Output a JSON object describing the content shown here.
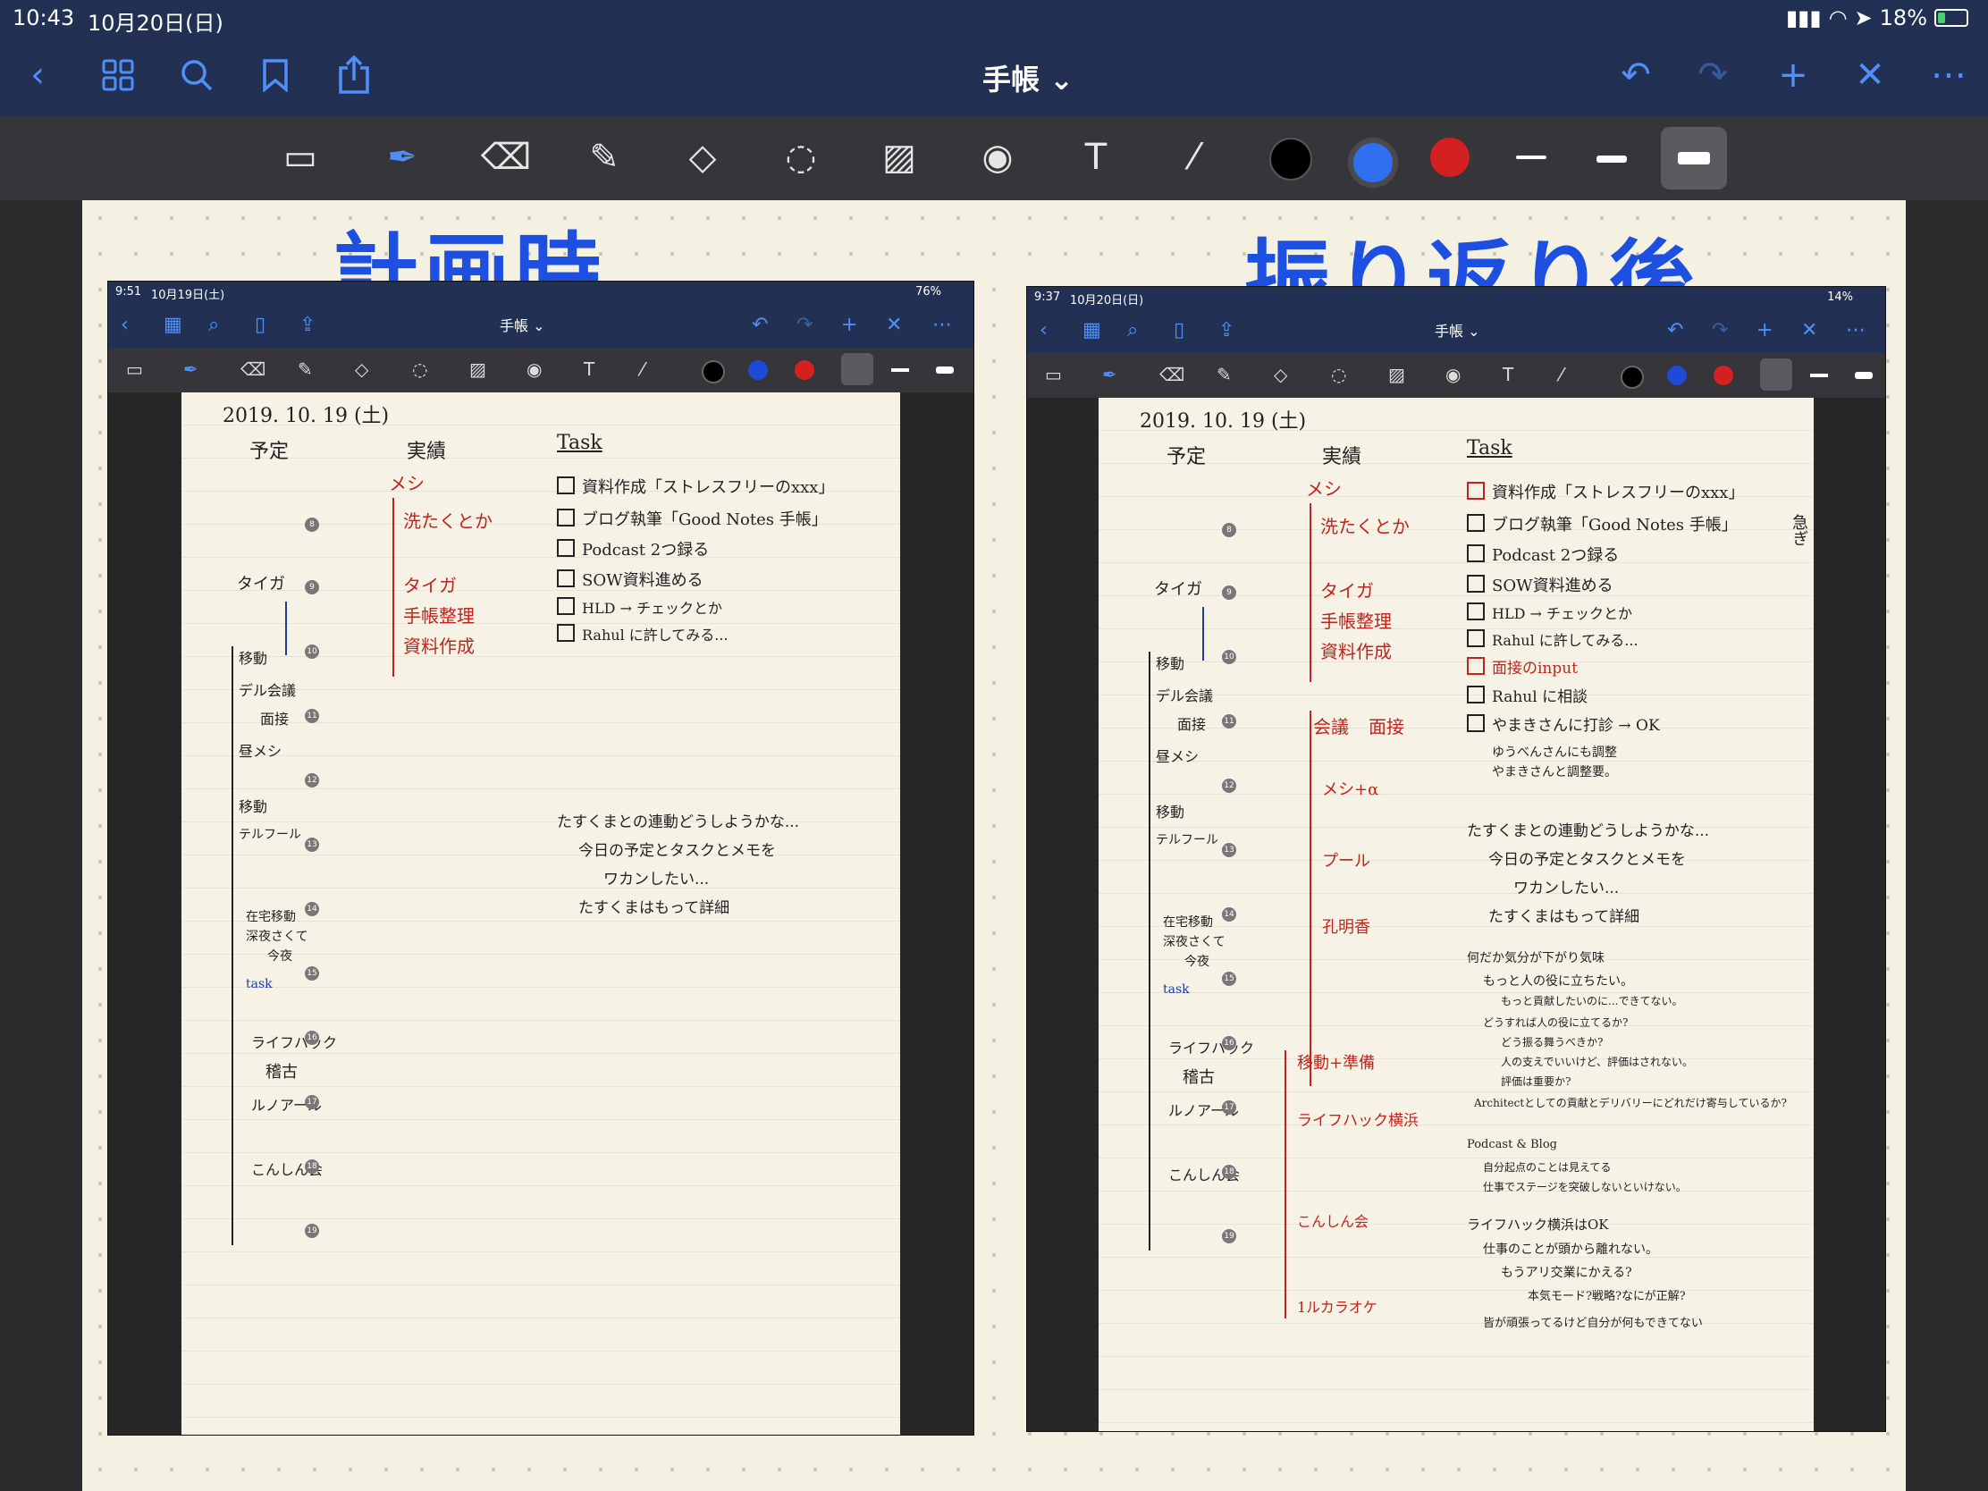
{
  "status": {
    "time": "10:43",
    "date": "10月20日(日)",
    "battery": "18%"
  },
  "nav": {
    "title": "手帳 ⌄"
  },
  "headings": {
    "left": "計画時",
    "right": "振り返り後"
  },
  "left_shot": {
    "status_time": "9:51",
    "status_date": "10月19日(土)",
    "battery": "76%",
    "title": "手帳 ⌄",
    "date_line": "2019. 10. 19 (土)",
    "col_plan": "予定",
    "col_actual": "実績",
    "col_task": "Task",
    "plan": [
      "タイガ",
      "移動",
      "デル会議",
      "面接",
      "昼メシ",
      "移動",
      "テルフール",
      "在宅移動",
      "深夜さくて",
      "今夜",
      "task",
      "ライフハック",
      "稽古",
      "ルノアール",
      "こんしん会"
    ],
    "actual": [
      "メシ",
      "洗たくとか",
      "タイガ",
      "手帳整理",
      "資料作成"
    ],
    "tasks": [
      "資料作成「ストレスフリーのxxx」",
      "ブログ執筆「Good Notes 手帳」",
      "Podcast 2つ録る",
      "SOW資料進める",
      "HLD → チェックとか",
      "Rahul に許してみる..."
    ],
    "memo": [
      "たすくまとの連動どうしようかな...",
      "今日の予定とタスクとメモを",
      "ワカンしたい...",
      "たすくまはもって詳細"
    ]
  },
  "right_shot": {
    "status_time": "9:37",
    "status_date": "10月20日(日)",
    "battery": "14%",
    "title": "手帳 ⌄",
    "date_line": "2019. 10. 19 (土)",
    "col_plan": "予定",
    "col_actual": "実績",
    "col_task": "Task",
    "plan": [
      "タイガ",
      "移動",
      "デル会議",
      "面接",
      "昼メシ",
      "移動",
      "テルフール",
      "在宅移動",
      "深夜さくて",
      "今夜",
      "task",
      "ライフハック",
      "稽古",
      "ルノアール",
      "こんしん会"
    ],
    "actual": [
      "メシ",
      "洗たくとか",
      "タイガ",
      "手帳整理",
      "資料作成",
      "会議",
      "面接",
      "メシ+α",
      "プール",
      "孔明香",
      "移動+準備",
      "ライフハック横浜",
      "こんしん会",
      "1ルカラオケ"
    ],
    "tasks": [
      "資料作成「ストレスフリーのxxx」",
      "ブログ執筆「Good Notes 手帳」",
      "Podcast 2つ録る",
      "SOW資料進める",
      "HLD → チェックとか",
      "Rahul に許してみる..."
    ],
    "added_tasks": [
      "面接のinput",
      "Rahul に相談",
      "やまきさんに打診 → OK",
      "ゆうべんさんにも調整",
      "やまきさんと調整要。"
    ],
    "memo": [
      "たすくまとの連動どうしようかな...",
      "今日の予定とタスクとメモを",
      "ワカンしたい...",
      "たすくまはもって詳細"
    ],
    "reflections": [
      "何だか気分が下がり気味",
      "もっと人の役に立ちたい。",
      "もっと貢献したいのに...できてない。",
      "どうすれば人の役に立てるか?",
      "どう振る舞うべきか?",
      "人の支えでいいけど、評価はされない。",
      "評価は重要か?",
      "Architectとしての貢献とデリバリーにどれだけ寄与しているか?",
      "Podcast & Blog",
      "自分起点のことは見えてる",
      "仕事でステージを突破しないといけない。",
      "ライフハック横浜はOK",
      "仕事のことが頭から離れない。",
      "もうアリ交業にかえる?",
      "本気モード?戦略?なにが正解?",
      "皆が頑張ってるけど自分が何もできてない"
    ],
    "hint_vertical": "急ぎ"
  },
  "colors": {
    "accent": "#4f8ff7",
    "ink_blue": "#1d4fe0",
    "ink_red": "#c2231d",
    "paper": "#f4f1e3",
    "nav": "#223153"
  },
  "icons": [
    "back-icon",
    "grid-icon",
    "search-icon",
    "bookmark-icon",
    "share-icon",
    "undo-icon",
    "redo-icon",
    "add-icon",
    "close-icon",
    "more-icon"
  ]
}
